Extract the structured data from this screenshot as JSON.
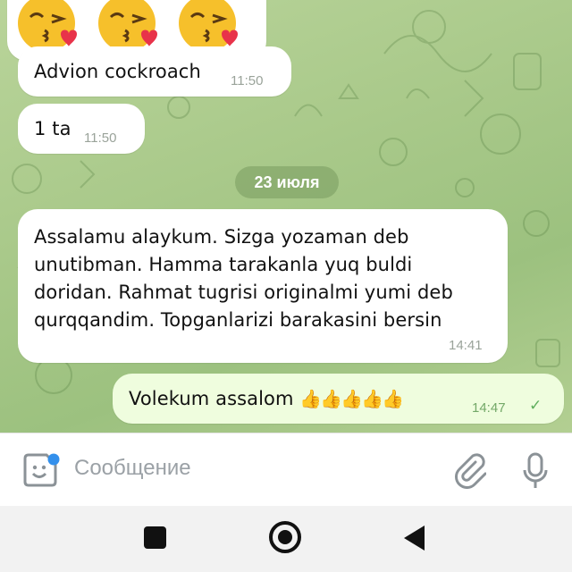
{
  "messages": [
    {
      "type": "emoji",
      "emojis": [
        "kissing-heart-emoji",
        "kissing-heart-emoji",
        "kissing-heart-emoji"
      ]
    },
    {
      "type": "in",
      "text": "Advion cockroach",
      "time": "11:50"
    },
    {
      "type": "in",
      "text": "1 ta",
      "time": "11:50"
    },
    {
      "type": "date",
      "text": "23 июля"
    },
    {
      "type": "in",
      "text": "Assalamu alaykum. Sizga yozaman deb\nunutibman. Hamma tarakanla yuq buldi\ndoridan. Rahmat tugrisi originalmi yumi deb\nqurqqandim. Topganlarizi barakasini bersin",
      "time": "14:41"
    },
    {
      "type": "out",
      "text": "Volekum assalom",
      "emoji": "👍👍👍👍👍",
      "time": "14:47",
      "status": "sent"
    }
  ],
  "input": {
    "placeholder": "Сообщение"
  },
  "colors": {
    "chat_bg": "#a9c98a",
    "incoming": "#ffffff",
    "outgoing": "#effdde",
    "accent": "#3390ec"
  }
}
